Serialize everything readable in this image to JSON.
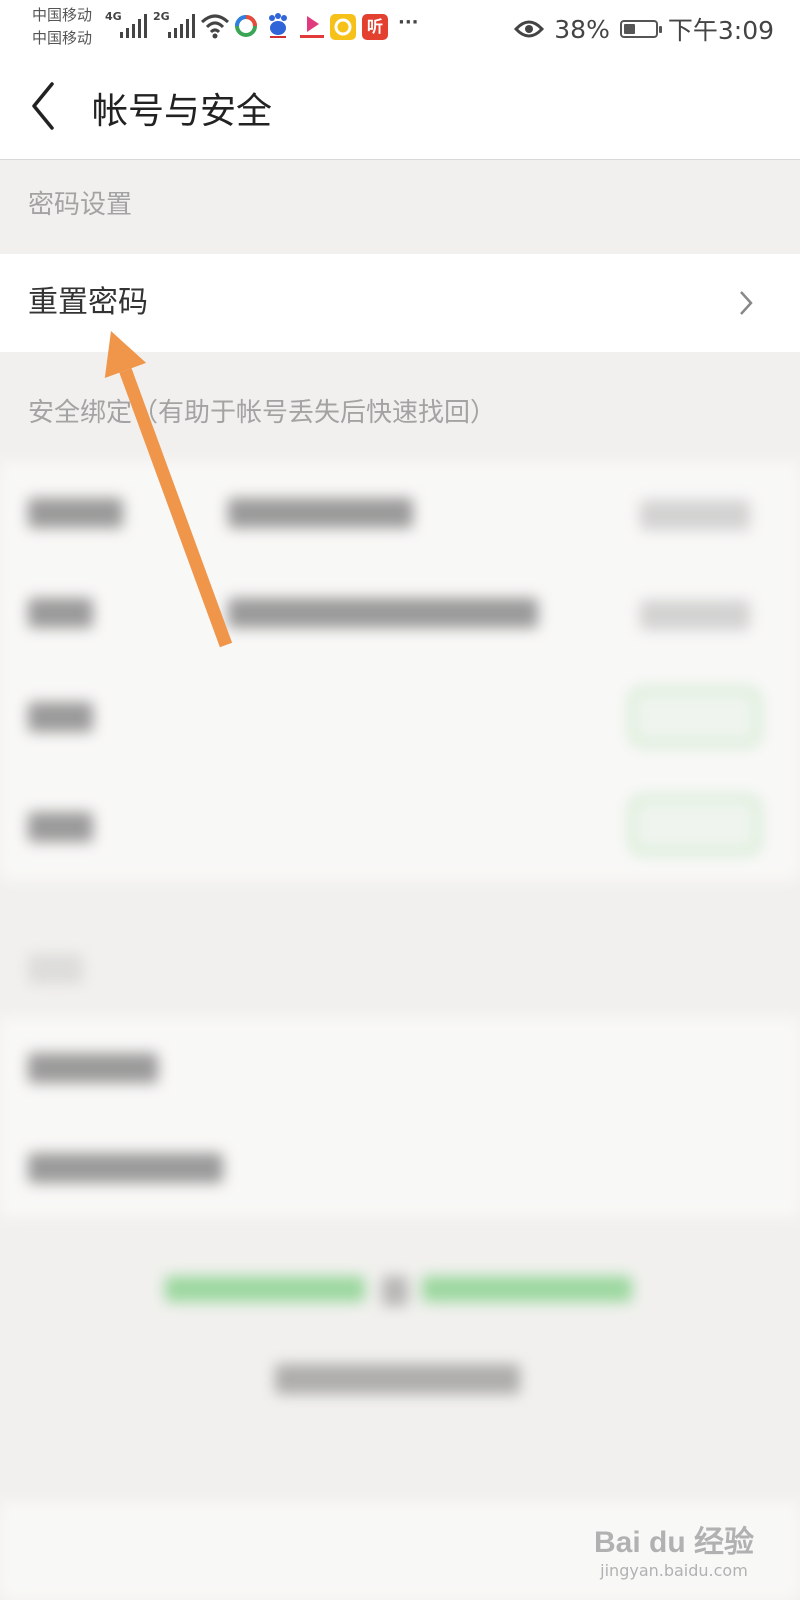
{
  "status_bar": {
    "carrier_1": "中国移动",
    "carrier_2": "中国移动",
    "network_1": "4G",
    "network_2": "2G",
    "more": "···",
    "battery_percent": "38%",
    "battery_level": 0.38,
    "time": "下午3:09",
    "icons": [
      "signal-icon",
      "wifi-icon",
      "app-icon",
      "baidu-icon",
      "video-app-icon",
      "notes-app-icon",
      "listen-app-icon",
      "eye-protection-icon",
      "battery-icon"
    ]
  },
  "header": {
    "title": "帐号与安全",
    "back_icon": "back-arrow-icon"
  },
  "password_section": {
    "header": "密码设置",
    "reset_password": "重置密码"
  },
  "binding_section": {
    "header": "安全绑定（有助于帐号丢失后快速找回）"
  },
  "annotation": {
    "arrow_color": "#f0964b"
  },
  "watermark": {
    "logo": "Bai du 经验",
    "url": "jingyan.baidu.com"
  }
}
